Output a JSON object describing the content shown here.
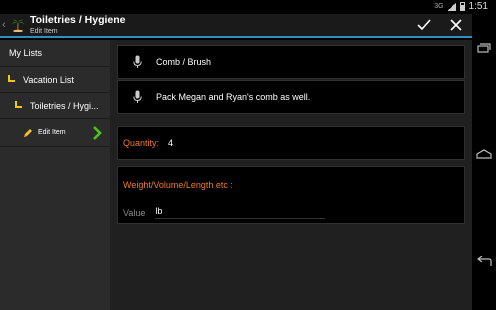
{
  "status": {
    "network": "3G",
    "time": "1:51"
  },
  "actionbar": {
    "title": "Toiletries / Hygiene",
    "subtitle": "Edit Item"
  },
  "sidebar": {
    "items": [
      {
        "label": "My Lists"
      },
      {
        "label": "Vacation List"
      },
      {
        "label": "Toiletries / Hygi..."
      },
      {
        "label": "Edit Item"
      }
    ]
  },
  "item": {
    "name": "Comb / Brush",
    "note": "Pack Megan and Ryan's comb as well."
  },
  "quantity": {
    "label": "Quantity:",
    "value": "4"
  },
  "measure": {
    "title": "Weight/Volume/Length etc :",
    "value_label": "Value",
    "value": "lb"
  },
  "colors": {
    "accent_blue": "#2f8fc4",
    "accent_orange": "#f07a2a",
    "folder_yellow": "#f2c51b",
    "chevron_green": "#4cc417"
  },
  "icons": [
    "back-chevron-icon",
    "palm-tree-icon",
    "checkmark-icon",
    "close-icon",
    "microphone-icon",
    "folder-icon",
    "pencil-icon",
    "chevron-right-icon",
    "recent-apps-icon",
    "home-icon",
    "back-icon"
  ]
}
